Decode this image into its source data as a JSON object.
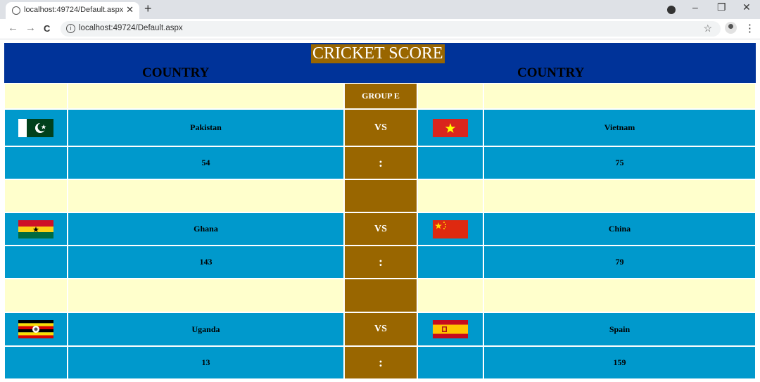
{
  "browser": {
    "tab_title": "localhost:49724/Default.aspx",
    "tab_close": "✕",
    "new_tab": "+",
    "url": "localhost:49724/Default.aspx",
    "back": "←",
    "forward": "→",
    "reload": "C",
    "minimize": "–",
    "restore": "❐",
    "close": "✕",
    "bookmark": "☆",
    "menu": "⋮",
    "info": "i"
  },
  "header": {
    "title": "CRICKET SCORE",
    "left_label": "COUNTRY",
    "right_label": "COUNTRY"
  },
  "colors": {
    "header_bg": "#003399",
    "accent_brown": "#996600",
    "row_blue": "#0099cc",
    "row_cream": "#ffffcc"
  },
  "group_label": "GROUP E",
  "matches": [
    {
      "team1": "Pakistan",
      "flag1": "pakistan-flag",
      "team2": "Vietnam",
      "flag2": "vietnam-flag",
      "vs": "VS",
      "score1": "54",
      "sep": ":",
      "score2": "75"
    },
    {
      "team1": "Ghana",
      "flag1": "ghana-flag",
      "team2": "China",
      "flag2": "china-flag",
      "vs": "VS",
      "score1": "143",
      "sep": ":",
      "score2": "79"
    },
    {
      "team1": "Uganda",
      "flag1": "uganda-flag",
      "team2": "Spain",
      "flag2": "spain-flag",
      "vs": "VS",
      "score1": "13",
      "sep": ":",
      "score2": "159"
    }
  ]
}
